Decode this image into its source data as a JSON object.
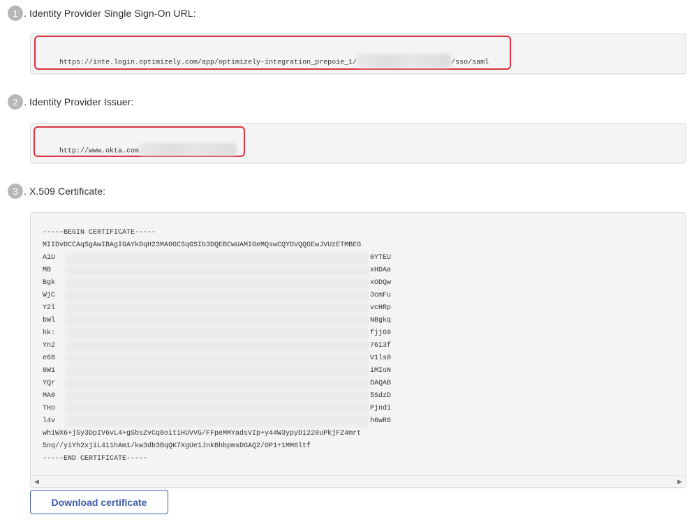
{
  "steps": [
    {
      "number": "1",
      "label": ". Identity Provider Single Sign-On URL:"
    },
    {
      "number": "2",
      "label": ". Identity Provider Issuer:"
    },
    {
      "number": "3",
      "label": ". X.509 Certificate:"
    }
  ],
  "sso_url": {
    "prefix": "https://inte.login.optimizely.com/app/optimizely-integration_prepoie_1/",
    "suffix": "/sso/saml"
  },
  "issuer": {
    "prefix": "http://www.okta.com"
  },
  "certificate": {
    "lines": [
      "-----BEGIN CERTIFICATE-----",
      "MIIDvDCCAqSgAwIBAgIGAYkDqH23MA0GCSqGSIb3DQEBCwUAMIGeMQswCQYDVQQGEwJVUzETMBEG",
      "A1U",
      "MB",
      "Bgk",
      "WjC",
      "Y2l",
      "bWl",
      "hk:",
      "Yn2",
      "e68",
      "0W1",
      "YQr",
      "MA0",
      "THo",
      "l4v",
      "wh1WX6+jSy3DpIV6vL4+gSbsZvCq8oitiHUVVG/FFpeMMYadsVIp+y44W3ypyDi220uPkjFZ4mrt",
      "5nq//yiYh2xjiL4i1hAm1/kw3db3BqQK7XgUe1JnkBhbpmsDGAQ2/OP1+1MM6ltf",
      "-----END CERTIFICATE-----"
    ],
    "line_endings": [
      "",
      "",
      "0YTEU",
      "xHDAa",
      "xODQw",
      "3cmFu",
      "vcHRp",
      "NBgkq",
      "fjjG9",
      "7613f",
      "V1ls0",
      "iMIoN",
      "DAQAB",
      "5SdzD",
      "Pjnd1",
      "h6wR6",
      "",
      "",
      ""
    ],
    "blurred_rows": [
      2,
      3,
      4,
      5,
      6,
      7,
      8,
      9,
      10,
      11,
      12,
      13,
      14,
      15
    ]
  },
  "scrollbar": {
    "left_arrow": "◀",
    "right_arrow": "▶"
  },
  "download_button": {
    "label": "Download certificate"
  },
  "colors": {
    "highlight": "#d9333f",
    "button": "#3b5ba9",
    "step_badge": "#b7b7b7"
  }
}
